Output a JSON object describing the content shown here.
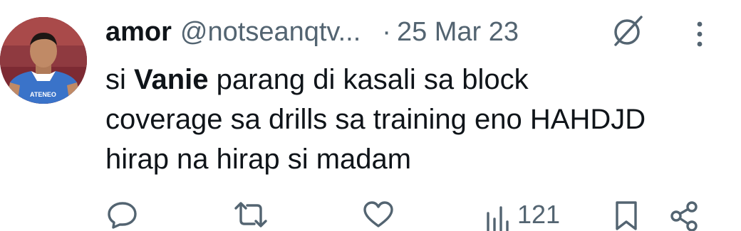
{
  "tweet": {
    "display_name": "amor",
    "handle": "@notseanqtv...",
    "separator": "·",
    "date": "25 Mar 23",
    "body": {
      "prefix": "si ",
      "bold": "Vanie",
      "line1_rest": " parang di kasali sa block",
      "line2": "coverage sa drills sa training eno HAHDJD",
      "line3": "hirap na hirap si madam"
    }
  },
  "actions": {
    "views_count": "121"
  },
  "icons": {
    "header": [
      "slash-icon",
      "more-vertical-icon"
    ],
    "action_bar": [
      "reply-icon",
      "retweet-icon",
      "like-icon",
      "views-icon",
      "bookmark-icon",
      "share-icon"
    ]
  },
  "colors": {
    "text": "#0f1419",
    "secondary": "#536471",
    "avatar_jersey": "#3a73c9",
    "avatar_background": "#7d2a33"
  }
}
